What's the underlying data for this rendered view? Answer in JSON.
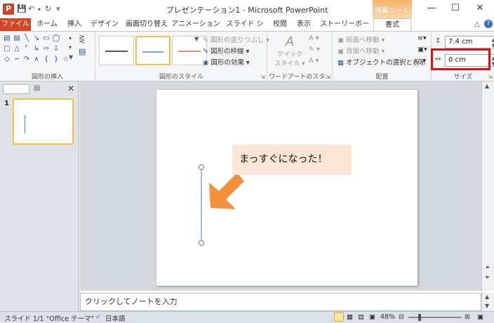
{
  "titlebar": {
    "app_icon": "P",
    "title": "プレゼンテーション1 - Microsoft PowerPoint",
    "context_label": "描画ツール",
    "quick_access": [
      "save-icon",
      "undo-icon",
      "redo-icon",
      "customize-icon"
    ],
    "controls": [
      "minimize-icon",
      "maximize-icon",
      "close-icon"
    ]
  },
  "tabs": [
    "ファイル",
    "ホーム",
    "挿入",
    "デザイン",
    "画面切り替え",
    "アニメーション",
    "スライド ショー",
    "校閲",
    "表示",
    "ストーリーボード",
    "書式"
  ],
  "ribbon": {
    "groups": {
      "insert_shapes": "図形の挿入",
      "shape_styles": "図形のスタイル",
      "wordart_styles": "ワードアートのスタ...",
      "arrange": "配置",
      "size": "サイズ"
    },
    "shape_style_cmds": {
      "fill": "図形の塗りつぶし",
      "outline": "図形の枠線",
      "effects": "図形の効果"
    },
    "quick_style": {
      "line1": "クイック",
      "line2": "スタイル"
    },
    "arrange_cmds": {
      "bring_forward": "前面へ移動",
      "send_backward": "背面へ移動",
      "selection_pane": "オブジェクトの選択と表示"
    },
    "size": {
      "height": "7.4 cm",
      "width": "0 cm"
    },
    "colors": {
      "accent": "#d24726",
      "highlight": "#e01010",
      "selected_style": "#f5c242"
    }
  },
  "slide_panel": {
    "slide_number": "1"
  },
  "slide": {
    "callout_text": "まっすぐになった！"
  },
  "notes": {
    "placeholder": "クリックしてノートを入力"
  },
  "status": {
    "slide": "スライド 1/1",
    "theme": "\"Office テーマ\"",
    "language": "日本語",
    "zoom": "48%"
  }
}
